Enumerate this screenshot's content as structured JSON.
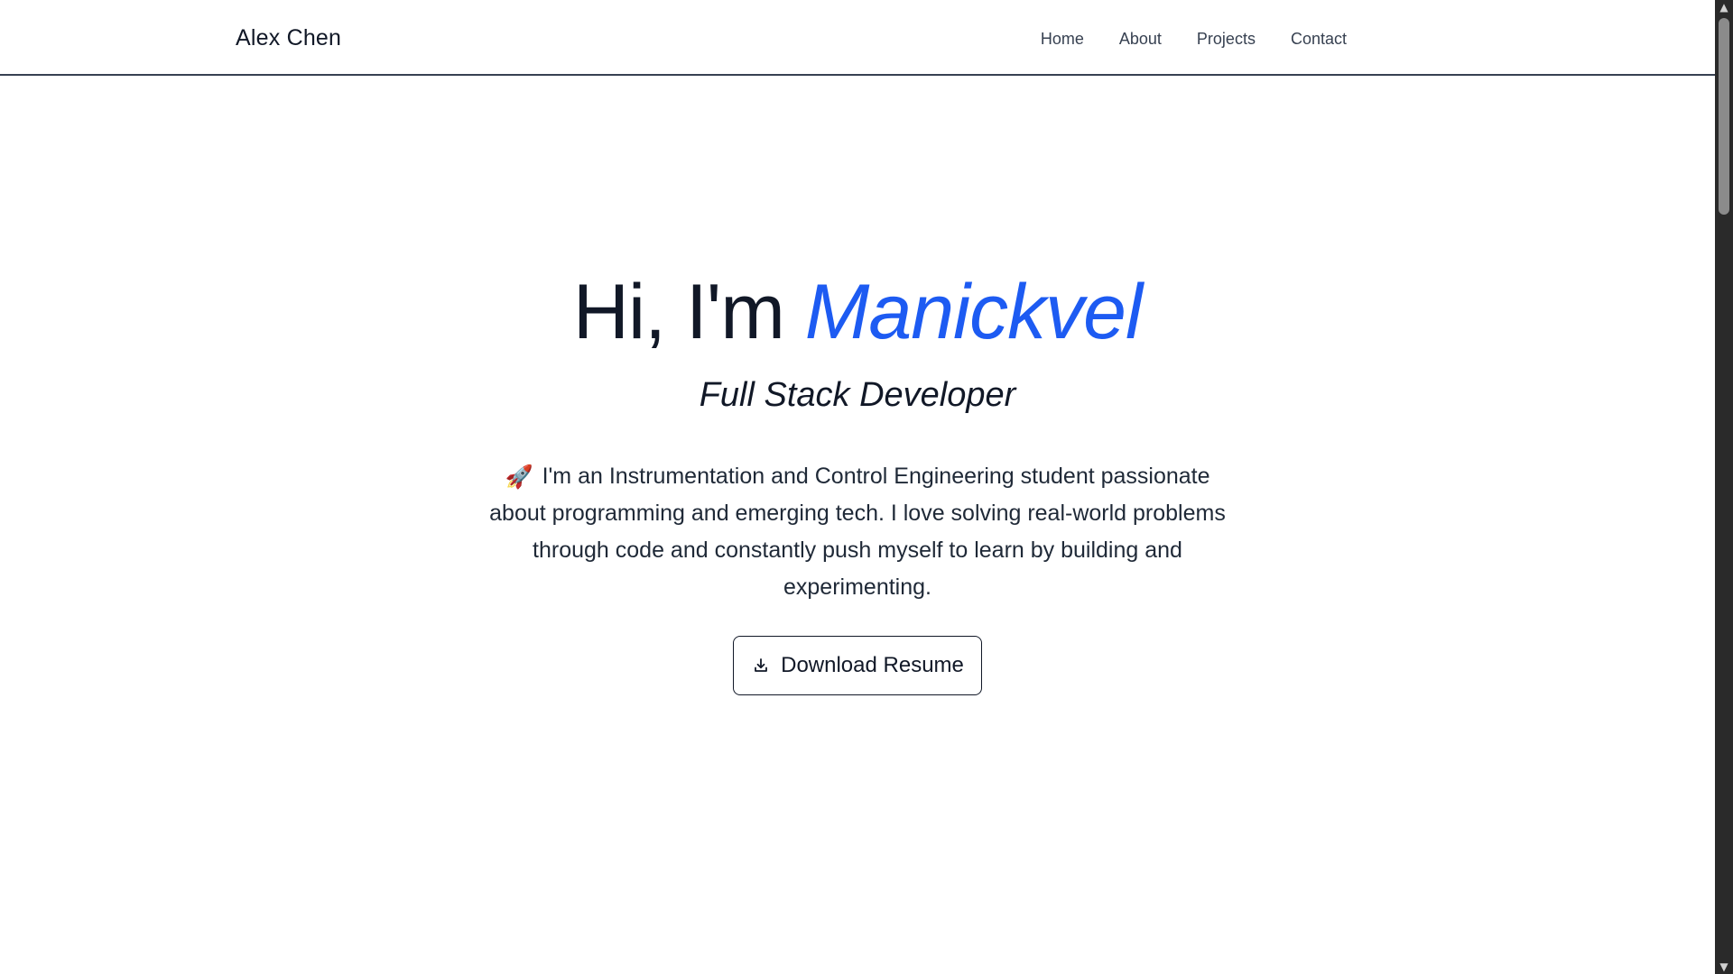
{
  "site": {
    "brand": "Alex Chen",
    "nav": [
      "Home",
      "About",
      "Projects",
      "Contact"
    ]
  },
  "hero": {
    "title_prefix": "Hi, I'm ",
    "name": "Manickvel",
    "role": "Full Stack Developer",
    "description_icon": "🚀",
    "description": "I'm an Instrumentation and Control Engineering student passionate about programming and emerging tech. I love solving real-world problems through code and constantly push myself to learn by building and experimenting.",
    "button_label": "Download Resume",
    "button_icon": "download-icon"
  },
  "colors": {
    "accent": "#1d5bf2",
    "text": "#111827",
    "nav_text": "#374151",
    "scrollbar": "#2a2a2a",
    "scroll_thumb": "#8b8b8b"
  },
  "scrollbar": {
    "up_icon": "scroll-up-arrow-icon",
    "down_icon": "scroll-down-arrow-icon"
  }
}
